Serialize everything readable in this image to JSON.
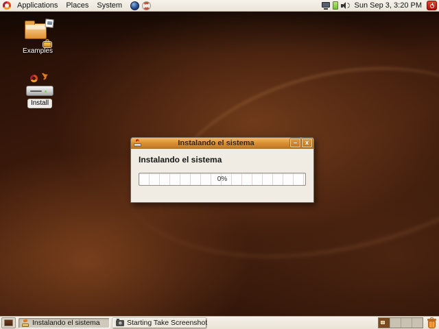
{
  "panel": {
    "logo_icon": "ubuntu-logo",
    "menus": [
      {
        "label": "Applications"
      },
      {
        "label": "Places"
      },
      {
        "label": "System"
      }
    ],
    "launchers": [
      {
        "icon": "browser-globe-icon"
      },
      {
        "icon": "help-lifesaver-icon"
      }
    ],
    "tray": {
      "icons": [
        "display",
        "battery",
        "volume"
      ],
      "clock": "Sun Sep 3, 3:20 PM",
      "power_icon": "power-button"
    }
  },
  "desktop": {
    "icons": [
      {
        "label": "Examples",
        "icon": "folder-with-photo-and-lock-emblems"
      },
      {
        "label": "Install",
        "icon": "drive-with-ubuntu-arrow-emblem"
      }
    ]
  },
  "window": {
    "title": "Instalando el sistema",
    "titlebar_buttons": {
      "minimize": "–",
      "close": "x"
    },
    "heading": "Instalando el sistema",
    "progress": {
      "percent": 0,
      "label": "0%"
    }
  },
  "taskbar": {
    "tasks": [
      {
        "label": "Instalando el sistema",
        "icon": "install-window",
        "state": "active"
      },
      {
        "label": "Starting Take Screenshot",
        "icon": "camera",
        "state": "normal"
      }
    ],
    "workspace_switcher": {
      "count": 4,
      "active_index": 0
    },
    "trash_icon": "trash"
  },
  "colors": {
    "accent_orange": "#d9762b",
    "titlebar_top": "#f3b965",
    "titlebar_bottom": "#bf7a26",
    "panel_bg": "#f0ece3",
    "desktop_base": "#37170a"
  }
}
